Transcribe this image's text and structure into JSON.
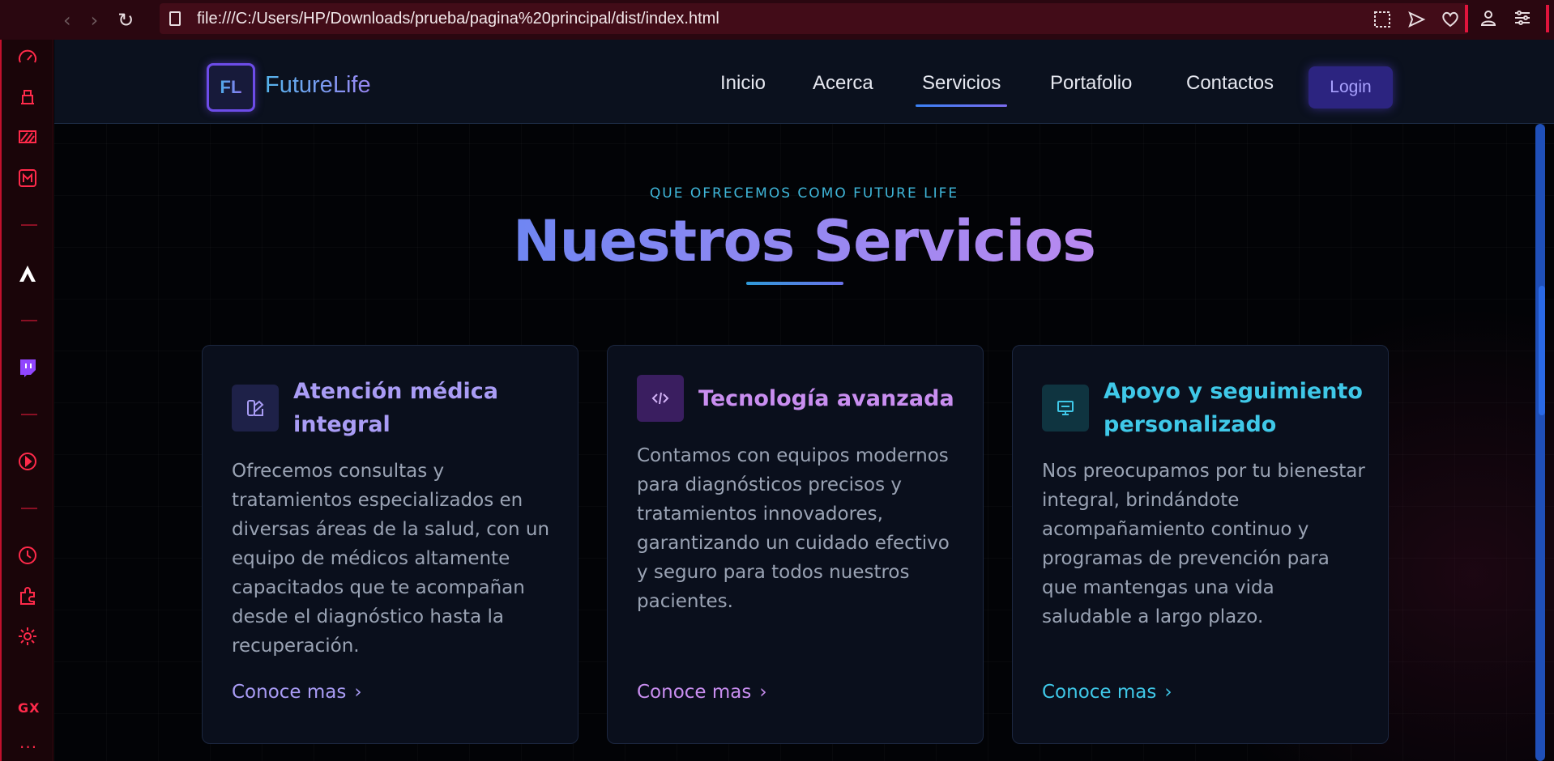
{
  "browser": {
    "url": "file:///C:/Users/HP/Downloads/prueba/pagina%20principal/dist/index.html",
    "accent_color": "#e0143c"
  },
  "header": {
    "logo_initials": "FL",
    "brand": "FutureLife",
    "nav": [
      "Inicio",
      "Acerca",
      "Servicios",
      "Portafolio",
      "Contactos"
    ],
    "active_nav": "Servicios",
    "login_label": "Login"
  },
  "sidebar": {
    "gx_label": "GX",
    "more_label": "···"
  },
  "section": {
    "eyebrow": "QUE OFRECEMOS COMO FUTURE LIFE",
    "title": "Nuestros Servicios"
  },
  "cards": [
    {
      "icon": "palette-icon",
      "title": "Atención médica integral",
      "description": "Ofrecemos consultas y tratamientos especializados en diversas áreas de la salud, con un equipo de médicos altamente capacitados que te acompañan desde el diagnóstico hasta la recuperación.",
      "link": "Conoce mas",
      "accent": "#a99cf5"
    },
    {
      "icon": "code-icon",
      "title": "Tecnología avanzada",
      "description": "Contamos con equipos modernos para diagnósticos precisos y tratamientos innovadores, garantizando un cuidado efectivo y seguro para todos nuestros pacientes.",
      "link": "Conoce mas",
      "accent": "#c98ef0"
    },
    {
      "icon": "monitor-icon",
      "title": "Apoyo y seguimiento personalizado",
      "description": "Nos preocupamos por tu bienestar integral, brindándote acompañamiento continuo y programas de prevención para que mantengas una vida saludable a largo plazo.",
      "link": "Conoce mas",
      "accent": "#3fc8e8"
    }
  ]
}
